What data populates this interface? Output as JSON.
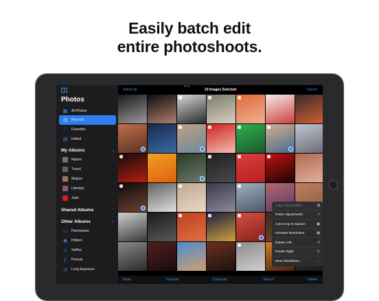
{
  "headline": {
    "line1": "Easily batch edit",
    "line2": "entire photoshoots."
  },
  "sidebar": {
    "title": "Photos",
    "top_items": [
      {
        "label": "All Photos",
        "icon": "photo-grid-icon",
        "selected": false
      },
      {
        "label": "Recents",
        "icon": "clock-icon",
        "selected": true
      },
      {
        "label": "Favorites",
        "icon": "heart-icon",
        "selected": false
      },
      {
        "label": "Edited",
        "icon": "edit-icon",
        "selected": false
      }
    ],
    "my_albums_heading": "My Albums",
    "my_albums": [
      {
        "label": "Nature",
        "thumb_color": "#6a7a6a"
      },
      {
        "label": "Travel",
        "thumb_color": "#5a6470"
      },
      {
        "label": "Mojave",
        "thumb_color": "#9a7a5a"
      },
      {
        "label": "Lifestyle",
        "thumb_color": "#8a5a6a"
      },
      {
        "label": "Jade",
        "thumb_color": "#c8231e"
      }
    ],
    "shared_albums_heading": "Shared Albums",
    "other_albums_heading": "Other Albums",
    "other_albums": [
      {
        "label": "Panoramas",
        "icon": "panorama-icon"
      },
      {
        "label": "Hidden",
        "icon": "eye-icon"
      },
      {
        "label": "Selfies",
        "icon": "selfie-icon"
      },
      {
        "label": "Portrait",
        "icon": "portrait-icon"
      },
      {
        "label": "Long Exposure",
        "icon": "long-exposure-icon"
      }
    ]
  },
  "topbar": {
    "select_all": "Select all",
    "title": "10 Images Selected",
    "cancel": "Cancel"
  },
  "grid": {
    "cells": [
      {
        "colors": [
          "#1a1a1a",
          "#9a9a9a"
        ],
        "mark": false,
        "raw": false,
        "check": false
      },
      {
        "colors": [
          "#0d0d0d",
          "#b08070"
        ],
        "mark": false,
        "raw": false,
        "check": false
      },
      {
        "colors": [
          "#d8d8d8",
          "#2a2a2a"
        ],
        "mark": true,
        "raw": false,
        "check": false
      },
      {
        "colors": [
          "#7a7a6a",
          "#d8d0c0"
        ],
        "mark": true,
        "raw": false,
        "check": false
      },
      {
        "colors": [
          "#e06a3a",
          "#f0b090"
        ],
        "mark": true,
        "raw": false,
        "check": false
      },
      {
        "colors": [
          "#f0ece6",
          "#d04040"
        ],
        "mark": false,
        "raw": true,
        "check": false
      },
      {
        "colors": [
          "#3a2a2a",
          "#d06030"
        ],
        "mark": false,
        "raw": false,
        "check": false
      },
      {
        "colors": [
          "#c07050",
          "#5a3020"
        ],
        "mark": false,
        "raw": false,
        "check": true
      },
      {
        "colors": [
          "#1a2a50",
          "#3a6aa0"
        ],
        "mark": false,
        "raw": false,
        "check": false
      },
      {
        "colors": [
          "#c0a080",
          "#6a8aa0"
        ],
        "mark": true,
        "raw": false,
        "check": true
      },
      {
        "colors": [
          "#d02020",
          "#f0c0b0"
        ],
        "mark": true,
        "raw": false,
        "check": false
      },
      {
        "colors": [
          "#30b050",
          "#1a5a2a"
        ],
        "mark": true,
        "raw": false,
        "check": false
      },
      {
        "colors": [
          "#d0b090",
          "#4a6a90"
        ],
        "mark": true,
        "raw": false,
        "check": true
      },
      {
        "colors": [
          "#c0c8d0",
          "#6a6a7a"
        ],
        "mark": false,
        "raw": false,
        "check": false
      },
      {
        "colors": [
          "#1a0a0a",
          "#b02010"
        ],
        "mark": true,
        "raw": false,
        "check": false
      },
      {
        "colors": [
          "#f0a020",
          "#e06010"
        ],
        "mark": false,
        "raw": false,
        "check": false
      },
      {
        "colors": [
          "#2a3a2a",
          "#6a7a6a"
        ],
        "mark": false,
        "raw": true,
        "check": true
      },
      {
        "colors": [
          "#202020",
          "#4a4a4a"
        ],
        "mark": true,
        "raw": false,
        "check": false
      },
      {
        "colors": [
          "#d84040",
          "#b82020"
        ],
        "mark": true,
        "raw": false,
        "check": false
      },
      {
        "colors": [
          "#c01010",
          "#200505"
        ],
        "mark": true,
        "raw": false,
        "check": false
      },
      {
        "colors": [
          "#b06a50",
          "#e0b0a0"
        ],
        "mark": false,
        "raw": false,
        "check": false
      },
      {
        "colors": [
          "#0d0d0d",
          "#704030"
        ],
        "mark": true,
        "raw": false,
        "check": true
      },
      {
        "colors": [
          "#606060",
          "#e0e0e0"
        ],
        "mark": false,
        "raw": false,
        "check": false
      },
      {
        "colors": [
          "#c0a890",
          "#e8d8c8"
        ],
        "mark": true,
        "raw": false,
        "check": false
      },
      {
        "colors": [
          "#3a3a4a",
          "#8a8a9a"
        ],
        "mark": false,
        "raw": false,
        "check": false
      },
      {
        "colors": [
          "#a0b0c0",
          "#4a5a6a"
        ],
        "mark": true,
        "raw": false,
        "check": false
      },
      {
        "colors": [
          "#b06a6a",
          "#5a3a6a"
        ],
        "mark": false,
        "raw": false,
        "check": false
      },
      {
        "colors": [
          "#c08060",
          "#8a5a40"
        ],
        "mark": false,
        "raw": false,
        "check": false
      },
      {
        "colors": [
          "#d0d0d0",
          "#3a3a3a"
        ],
        "mark": false,
        "raw": false,
        "check": false
      },
      {
        "colors": [
          "#1a1a1a",
          "#5a5a5a"
        ],
        "mark": false,
        "raw": false,
        "check": false
      },
      {
        "colors": [
          "#c04020",
          "#e07040"
        ],
        "mark": true,
        "raw": false,
        "check": false
      },
      {
        "colors": [
          "#1a2040",
          "#d0a040"
        ],
        "mark": true,
        "raw": false,
        "check": false
      },
      {
        "colors": [
          "#d05040",
          "#8a2020"
        ],
        "mark": true,
        "raw": false,
        "check": true
      },
      {
        "colors": [
          "#3a2a20",
          "#6a4a30"
        ],
        "mark": false,
        "raw": false,
        "check": false
      },
      {
        "colors": [
          "#a06a40",
          "#2a1a10"
        ],
        "mark": false,
        "raw": false,
        "check": false
      },
      {
        "colors": [
          "#8a8a8a",
          "#2a2a2a"
        ],
        "mark": false,
        "raw": false,
        "check": false
      },
      {
        "colors": [
          "#502020",
          "#1a0a0a"
        ],
        "mark": false,
        "raw": false,
        "check": false
      },
      {
        "colors": [
          "#4a8ad0",
          "#d0a070"
        ],
        "mark": false,
        "raw": false,
        "check": false
      },
      {
        "colors": [
          "#703020",
          "#1a1010"
        ],
        "mark": false,
        "raw": false,
        "check": false
      },
      {
        "colors": [
          "#8a8a8a",
          "#d0d0d0"
        ],
        "mark": true,
        "raw": false,
        "check": false
      },
      {
        "colors": [
          "#d08020",
          "#4a2010"
        ],
        "mark": false,
        "raw": false,
        "check": false
      },
      {
        "colors": [
          "#3a3a3a",
          "#1a1a1a"
        ],
        "mark": false,
        "raw": false,
        "check": false
      }
    ]
  },
  "menu": {
    "items": [
      {
        "label": "Copy Adjustments",
        "icon": "copy-icon",
        "dim": true
      },
      {
        "label": "Paste Adjustments",
        "icon": "paste-icon",
        "dim": false
      },
      {
        "label": "Auto Crop to Square",
        "icon": "crop-icon",
        "dim": false
      },
      {
        "label": "Increase Resolution",
        "icon": "resolution-icon",
        "dim": false
      },
      {
        "label": "Rotate Left",
        "icon": "rotate-left-icon",
        "dim": false
      },
      {
        "label": "Rotate Right",
        "icon": "rotate-right-icon",
        "dim": false
      },
      {
        "label": "More Workflows...",
        "icon": "more-icon",
        "dim": false
      }
    ]
  },
  "bottombar": {
    "share": "Share",
    "favorite": "Favorite",
    "duplicate": "Duplicate",
    "revert": "Revert",
    "delete": "Delete"
  },
  "colors": {
    "accent": "#2f7ef0",
    "sidebar_bg": "#1c1c1e",
    "menu_bg": "#2c2c2e"
  }
}
